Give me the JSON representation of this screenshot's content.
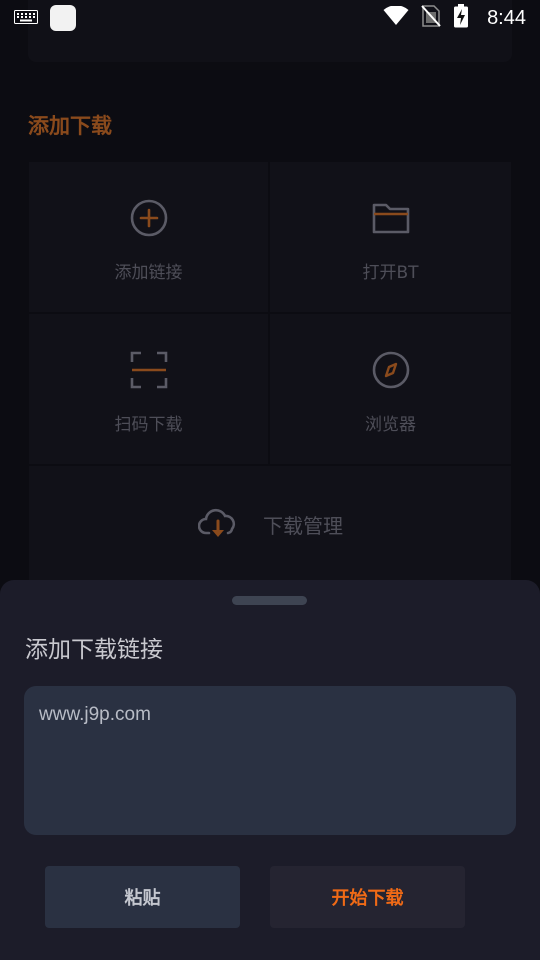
{
  "status_bar": {
    "time": "8:44",
    "icons": [
      "keyboard-icon",
      "app-notification-icon",
      "wifi-icon",
      "no-sim-icon",
      "battery-charging-icon"
    ]
  },
  "background_page": {
    "section_title": "添加下载",
    "actions": [
      {
        "label": "添加链接",
        "icon": "add-circle-icon"
      },
      {
        "label": "打开BT",
        "icon": "folder-icon"
      },
      {
        "label": "扫码下载",
        "icon": "scan-icon"
      },
      {
        "label": "浏览器",
        "icon": "compass-icon"
      }
    ],
    "download_manager": {
      "label": "下载管理",
      "icon": "cloud-download-icon"
    }
  },
  "sheet": {
    "title": "添加下载链接",
    "url_value": "www.j9p.com",
    "paste_label": "粘贴",
    "start_label": "开始下载"
  },
  "colors": {
    "accent": "#f06a16",
    "sheet_bg": "#1c1c29",
    "input_bg": "#2a3142"
  }
}
